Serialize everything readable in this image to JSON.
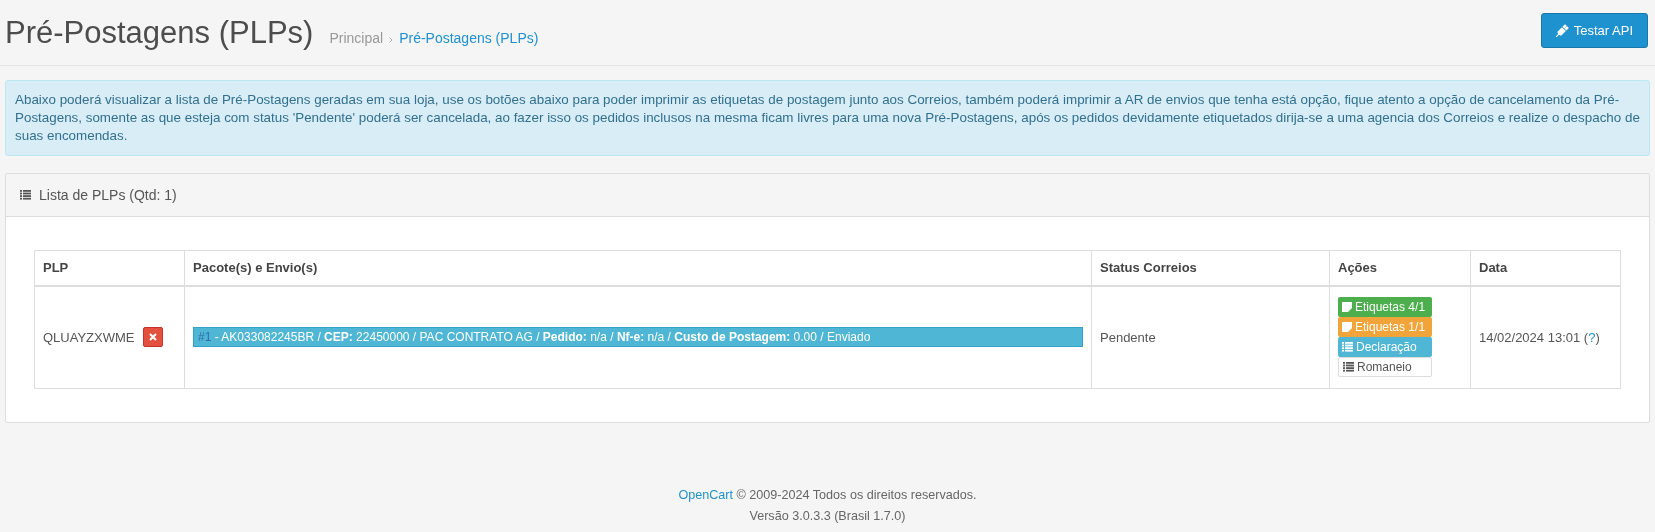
{
  "header": {
    "title": "Pré-Postagens (PLPs)",
    "breadcrumb": [
      {
        "label": "Principal",
        "selected": false
      },
      {
        "label": "Pré-Postagens (PLPs)",
        "selected": true
      }
    ],
    "button": "Testar API"
  },
  "alert": "Abaixo poderá visualizar a lista de Pré-Postagens geradas em sua loja, use os botões abaixo para poder imprimir as etiquetas de postagem junto aos Correios, também poderá imprimir a AR de envios que tenha está opção, fique atento a opção de cancelamento da Pré-Postagens, somente as que esteja com status 'Pendente' poderá ser cancelada, ao fazer isso os pedidos inclusos na mesma ficam livres para uma nova Pré-Postagens, após os pedidos devidamente etiquetados dirija-se a uma agencia dos Correios e realize o despacho de suas encomendas.",
  "panel": {
    "title": "Lista de PLPs (Qtd: 1)",
    "table": {
      "columns": [
        "PLP",
        "Pacote(s) e Envio(s)",
        "Status Correios",
        "Ações",
        "Data"
      ],
      "rows": [
        {
          "plp": "QLUAYZXWME",
          "shipments": [
            {
              "number": "#1",
              "text": " - AK033082245BR / **CEP:** 22450000 / PAC CONTRATO AG / **Pedido:** n/a / **Nf-e:** n/a / **Custo de Postagem:** 0.00 / Enviado"
            }
          ],
          "status": "Pendente",
          "actions": [
            {
              "kind": "success",
              "label": "Etiquetas 4/1"
            },
            {
              "kind": "warning",
              "label": "Etiquetas 1/1"
            },
            {
              "kind": "info",
              "label": "Declaração"
            },
            {
              "kind": "default",
              "label": "Romaneio"
            }
          ],
          "date": "14/02/2024 13:01 (",
          "help": "?",
          "date_end": ")"
        }
      ]
    }
  },
  "footer": {
    "link": "OpenCart",
    "copyright": " © 2009-2024 Todos os direitos reservados.",
    "version": "Versão 3.0.3.3 (Brasil 1.7.0)"
  }
}
